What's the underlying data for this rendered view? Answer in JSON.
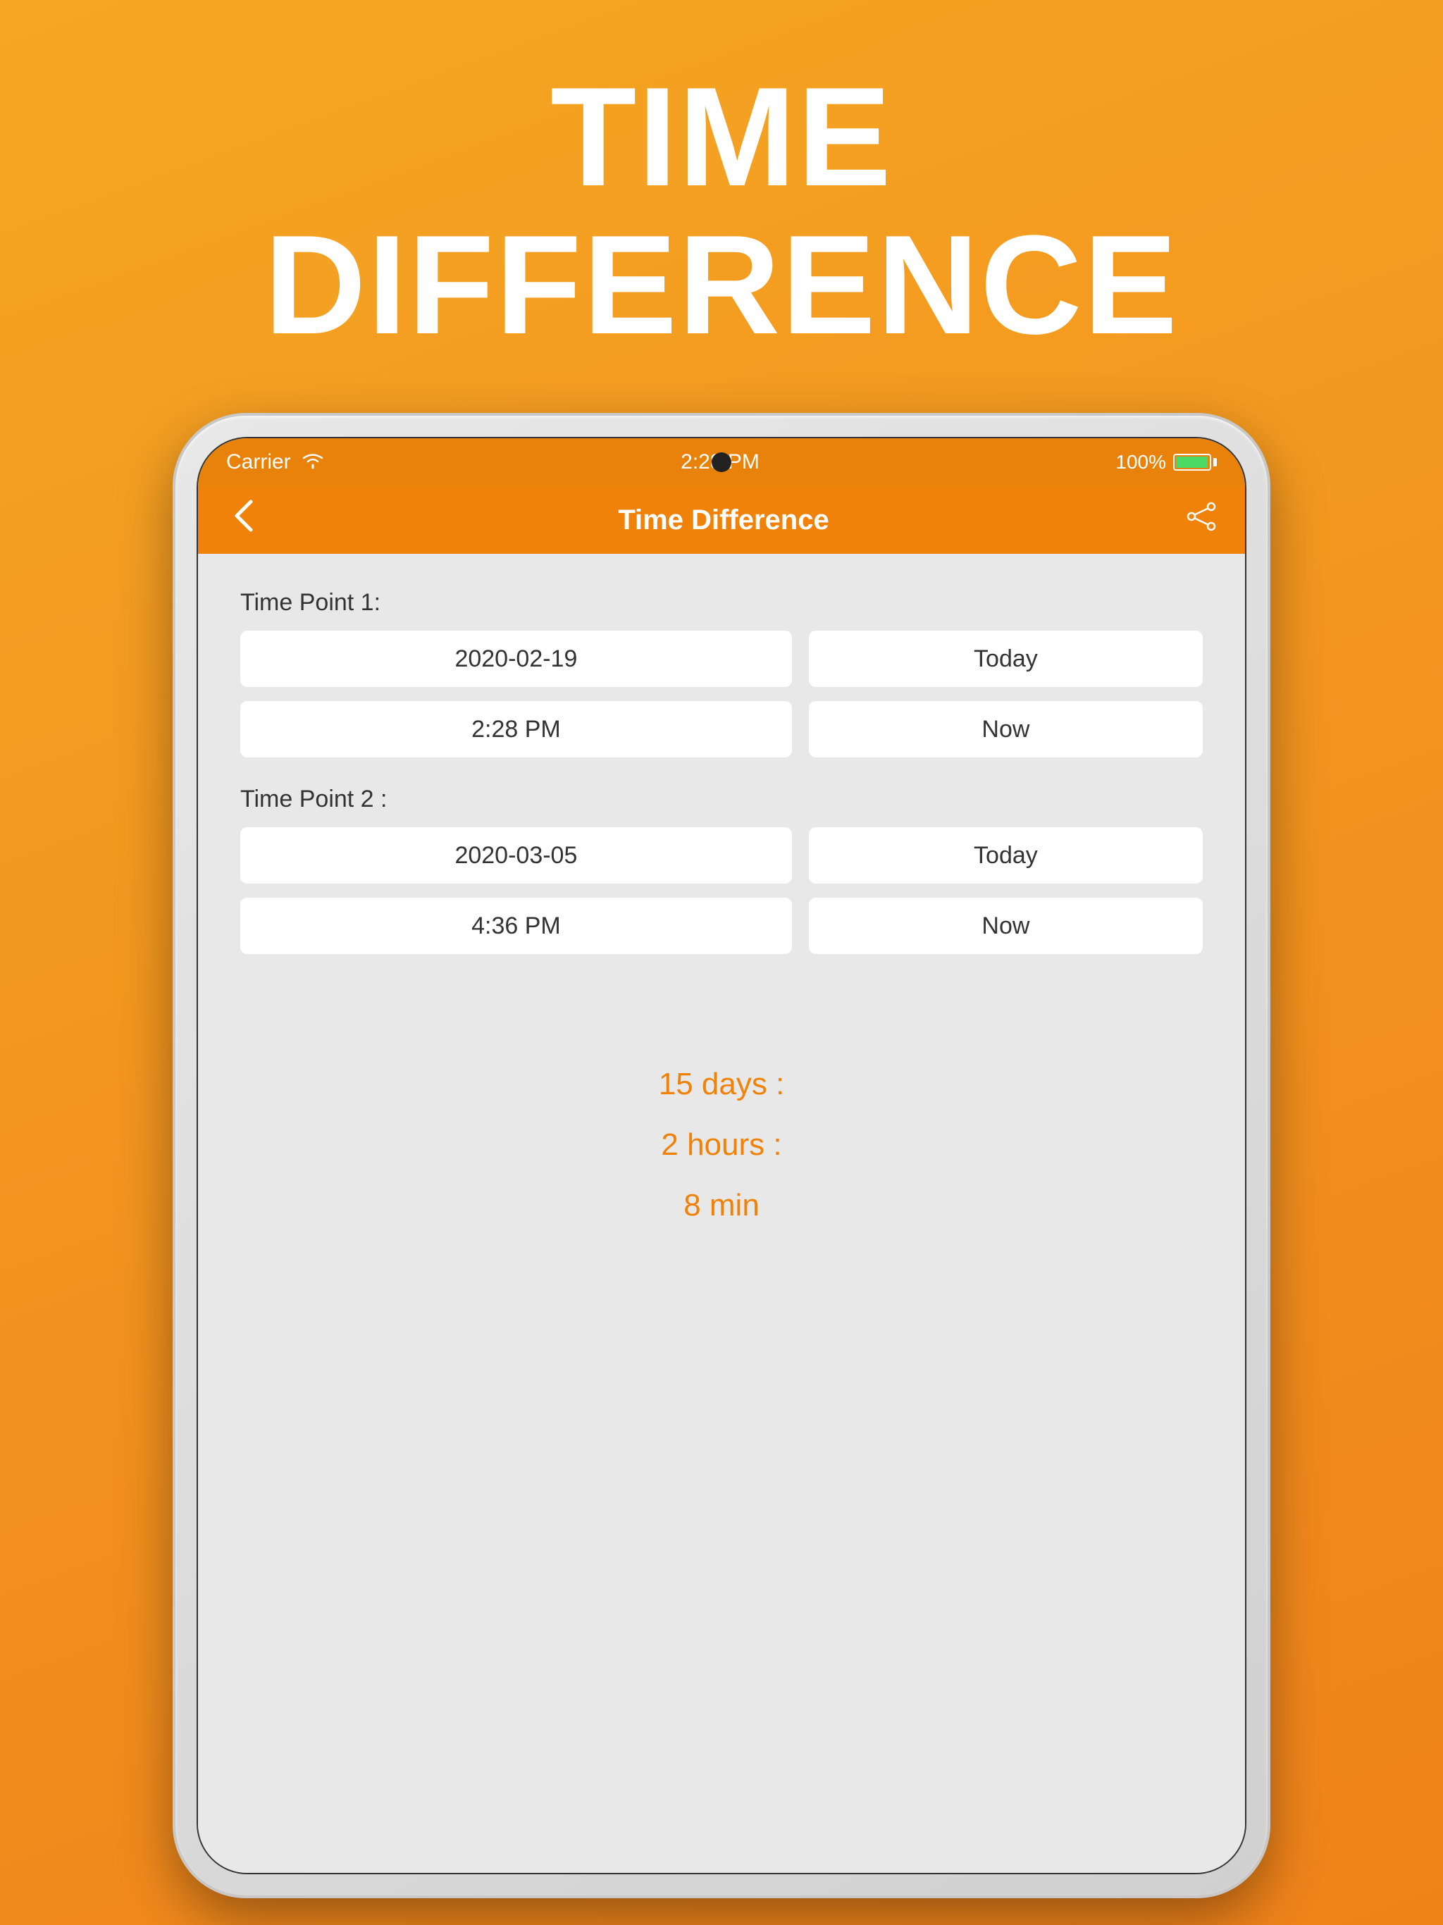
{
  "background": {
    "gradient_start": "#f5a623",
    "gradient_end": "#f0821a"
  },
  "app_title_line1": "TIME",
  "app_title_line2": "DIFFERENCE",
  "status_bar": {
    "carrier": "Carrier",
    "time": "2:28 PM",
    "battery_percent": "100%"
  },
  "nav": {
    "title": "Time Difference",
    "back_label": "<",
    "share_label": "share"
  },
  "time_point_1": {
    "label": "Time Point 1:",
    "date_value": "2020-02-19",
    "date_shortcut": "Today",
    "time_value": "2:28 PM",
    "time_shortcut": "Now"
  },
  "time_point_2": {
    "label": "Time Point 2 :",
    "date_value": "2020-03-05",
    "date_shortcut": "Today",
    "time_value": "4:36 PM",
    "time_shortcut": "Now"
  },
  "result": {
    "days": "15 days :",
    "hours": "2 hours :",
    "minutes": "8 min"
  }
}
